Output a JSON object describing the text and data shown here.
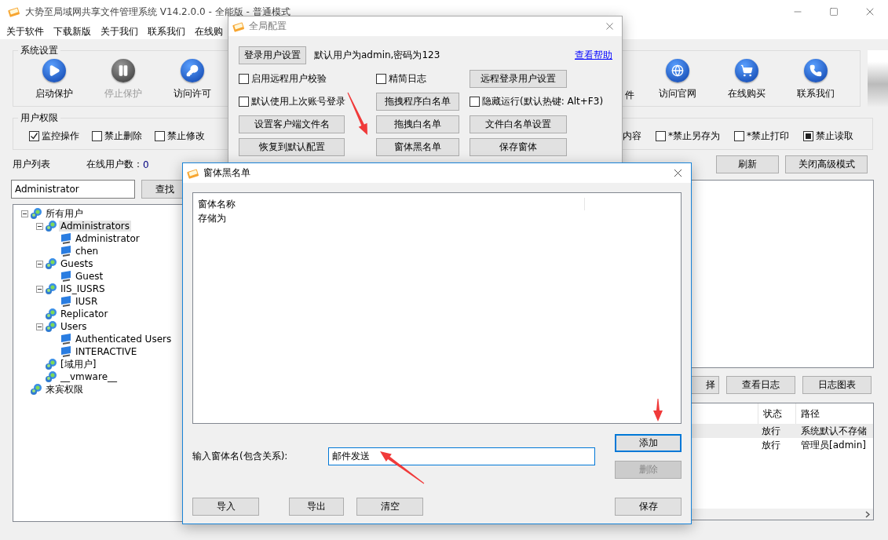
{
  "window": {
    "title": "大势至局域网共享文件管理系统 V14.2.0.0 - 全能版 - 普通模式"
  },
  "menu": [
    "关于软件",
    "下载新版",
    "关于我们",
    "联系我们",
    "在线购"
  ],
  "system_settings": {
    "title": "系统设置",
    "left_tools": [
      {
        "label": "启动保护",
        "disabled": false
      },
      {
        "label": "停止保护",
        "disabled": true
      },
      {
        "label": "访问许可",
        "disabled": false
      }
    ],
    "fragment": "件",
    "right_tools": [
      {
        "label": "访问官网",
        "disabled": false
      },
      {
        "label": "在线购买",
        "disabled": false
      },
      {
        "label": "联系我们",
        "disabled": false
      }
    ]
  },
  "permissions": {
    "title": "用户权限",
    "left": [
      {
        "label": "监控操作",
        "checked": true,
        "indeterminate": false
      },
      {
        "label": "禁止删除",
        "checked": false,
        "indeterminate": false
      },
      {
        "label": "禁止修改",
        "checked": false,
        "indeterminate": false
      }
    ],
    "fragment": "内容",
    "right": [
      {
        "label": "*禁止另存为",
        "checked": false,
        "indeterminate": false
      },
      {
        "label": "*禁止打印",
        "checked": false,
        "indeterminate": false
      },
      {
        "label": "禁止读取",
        "checked": false,
        "indeterminate": true
      }
    ]
  },
  "user_list": {
    "label": "用户列表",
    "online_label": "在线用户数：",
    "online_count": "0"
  },
  "top_buttons": [
    "刷新",
    "关闭高级模式"
  ],
  "search": {
    "value": "Administrator",
    "button": "查找"
  },
  "tree": [
    {
      "label": "所有用户",
      "kind": "group",
      "expanded": true,
      "selected": false,
      "children": [
        {
          "label": "Administrators",
          "kind": "group",
          "expanded": true,
          "selected": true,
          "children": [
            {
              "label": "Administrator",
              "kind": "user",
              "selected": false
            },
            {
              "label": "chen",
              "kind": "user",
              "selected": false
            }
          ]
        },
        {
          "label": "Guests",
          "kind": "group",
          "expanded": true,
          "selected": false,
          "children": [
            {
              "label": "Guest",
              "kind": "user",
              "selected": false
            }
          ]
        },
        {
          "label": "IIS_IUSRS",
          "kind": "group",
          "expanded": true,
          "selected": false,
          "children": [
            {
              "label": "IUSR",
              "kind": "user",
              "selected": false
            }
          ]
        },
        {
          "label": "Replicator",
          "kind": "group",
          "selected": false
        },
        {
          "label": "Users",
          "kind": "group",
          "expanded": true,
          "selected": false,
          "children": [
            {
              "label": "Authenticated Users",
              "kind": "user",
              "selected": false
            },
            {
              "label": "INTERACTIVE",
              "kind": "user",
              "selected": false
            }
          ]
        },
        {
          "label": "[域用户]",
          "kind": "group",
          "selected": false
        },
        {
          "label": "__vmware__",
          "kind": "group",
          "selected": false
        }
      ]
    },
    {
      "label": "来宾权限",
      "kind": "group",
      "selected": false
    }
  ],
  "log_buttons": [
    "择",
    "查看日志",
    "日志图表"
  ],
  "log_table": {
    "columns": [
      "状态",
      "路径"
    ],
    "rows": [
      {
        "cells": [
          "放行",
          "系统默认不存储"
        ],
        "selected": true
      },
      {
        "cells": [
          "放行",
          "管理员[admin]"
        ],
        "selected": false
      }
    ]
  },
  "global_config": {
    "title": "全局配置",
    "login_button": "登录用户设置",
    "default_info": "默认用户为admin,密码为123",
    "help_link": "查看帮助",
    "controls": [
      {
        "kind": "checkbox",
        "label": "启用远程用户校验",
        "checked": false
      },
      {
        "kind": "checkbox",
        "label": "精简日志",
        "checked": false
      },
      {
        "kind": "button",
        "label": "远程登录用户设置"
      },
      {
        "kind": "checkbox",
        "label": "默认使用上次账号登录",
        "checked": false
      },
      {
        "kind": "button",
        "label": "拖拽程序白名单"
      },
      {
        "kind": "checkbox",
        "label": "隐藏运行(默认热键: Alt+F3)",
        "checked": false
      },
      {
        "kind": "button",
        "label": "设置客户端文件名"
      },
      {
        "kind": "button",
        "label": "拖拽白名单"
      },
      {
        "kind": "button",
        "label": "文件白名单设置"
      },
      {
        "kind": "button",
        "label": "恢复到默认配置"
      },
      {
        "kind": "button",
        "label": "窗体黑名单"
      },
      {
        "kind": "button",
        "label": "保存窗体"
      }
    ]
  },
  "blacklist": {
    "title": "窗体黑名单",
    "column": "窗体名称",
    "rows": [
      "存储为"
    ],
    "input_label": "输入窗体名(包含关系):",
    "input_value": "邮件发送",
    "side_buttons": [
      {
        "label": "添加",
        "focused": true,
        "disabled": false
      },
      {
        "label": "删除",
        "focused": false,
        "disabled": true
      }
    ],
    "bottom_buttons": [
      "导入",
      "导出",
      "清空"
    ],
    "save_button": "保存"
  }
}
